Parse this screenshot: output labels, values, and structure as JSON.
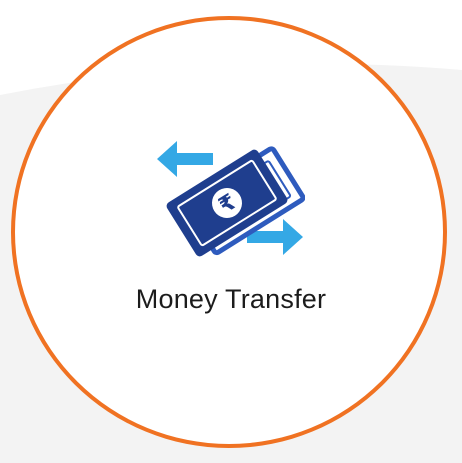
{
  "tile": {
    "label": "Money Transfer",
    "icon": "money-transfer-icon",
    "currency_symbol": "₹"
  },
  "colors": {
    "ring": "#F07222",
    "note_dark": "#1F3E8E",
    "note_light": "#2E5BBE",
    "arrow": "#34A8E5",
    "label": "#1c1c1c"
  }
}
